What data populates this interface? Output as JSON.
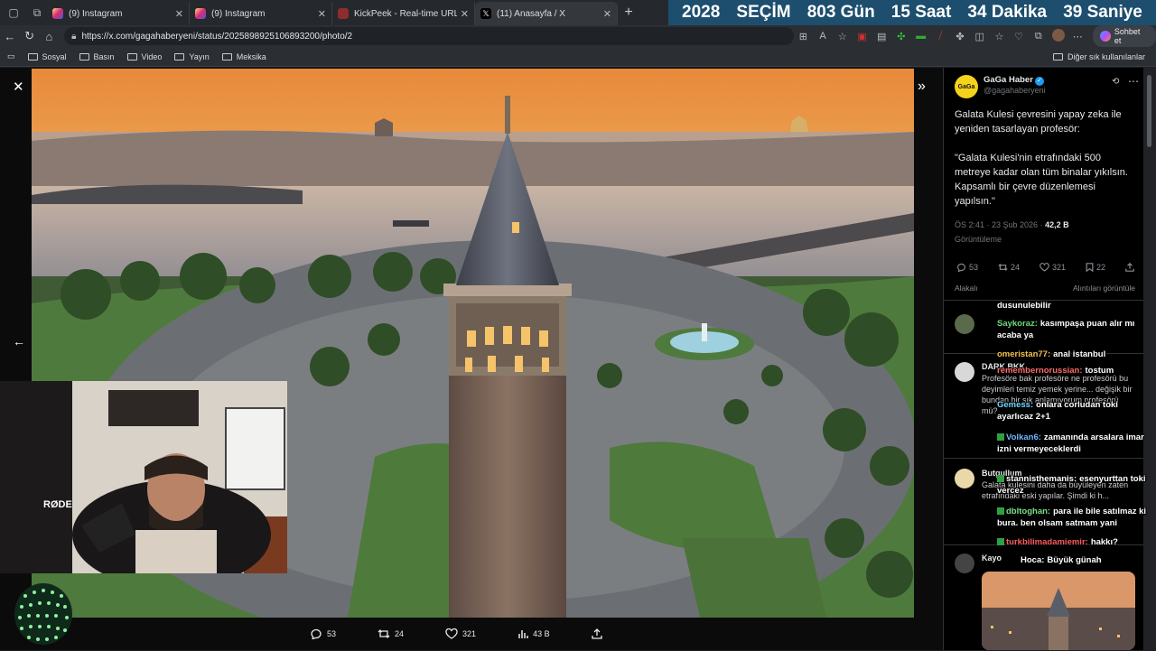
{
  "tabs": [
    {
      "title": "(9) Instagram",
      "favicon_color": "#d6306f"
    },
    {
      "title": "(9) Instagram",
      "favicon_color": "#d6306f"
    },
    {
      "title": "KickPeek - Real-time URL Crawler",
      "favicon_color": "#8e2d2d"
    },
    {
      "title": "(11) Anasayfa / X",
      "favicon_color": "#000000",
      "active": true
    }
  ],
  "banner": {
    "year": "2028",
    "label": "SEÇİM",
    "days": "803 Gün",
    "hours": "15 Saat",
    "minutes": "34 Dakika",
    "seconds": "39 Saniye"
  },
  "address": {
    "url": "https://x.com/gagahaberyeni/status/2025898925106893200/photo/2",
    "copilot_label": "Sohbet et"
  },
  "bookmarks": {
    "items": [
      "Sosyal",
      "Basın",
      "Video",
      "Yayın",
      "Meksika"
    ],
    "other": "Diğer sık kullanılanlar"
  },
  "viewer_actions": {
    "replies": "53",
    "reposts": "24",
    "likes": "321",
    "views": "43 B"
  },
  "tweet": {
    "name": "GaGa Haber",
    "handle": "@gagahaberyeni",
    "avatar_text": "GaGa",
    "text": "Galata Kulesi çevresini yapay zeka ile yeniden tasarlayan profesör:\n\n\"Galata Kulesi'nin etrafındaki 500 metreye kadar olan tüm binalar yıkılsın. Kapsamlı bir çevre düzenlemesi yapılsın.\"",
    "time": "ÖS 2:41 · 23 Şub 2026 · ",
    "views_count": "42,2 B",
    "views_label": "Görüntüleme",
    "replies": "53",
    "reposts": "24",
    "likes": "321",
    "bookmarks": "22",
    "sort_label": "Alakalı",
    "quotes_label": "Alıntıları görüntüle"
  },
  "replies": [
    {
      "name": "DARK BKK",
      "text": "Profesöre bak profesöre ne profesörü bu deyimleri temiz yemek yerine... değişik bir bundan bir şık anlamıyorum profesörü mü?"
    },
    {
      "name": "Butgullum",
      "text": "Galata kulesini daha da büyüleyen zaten etrafındaki eski yapılar. Şimdi ki h..."
    },
    {
      "name": "Kayo",
      "text": ""
    }
  ],
  "chat": [
    {
      "user": "",
      "text": "dusunulebilir"
    },
    {
      "user": "Saykoraz:",
      "text": "kasımpaşa puan alır mı acaba ya"
    },
    {
      "user": "omeristan77:",
      "text": "anal istanbul"
    },
    {
      "user": "remembernorussian:",
      "text": "tostum"
    },
    {
      "user": "Gemess:",
      "text": "onlara corludan toki ayarlıcaz 2+1"
    },
    {
      "user": "Volkan6:",
      "text": "zamanında arsalara imar izni vermeyeceklerdi"
    },
    {
      "user": "stannisthemanis:",
      "text": "esenyurttan toki vercez"
    },
    {
      "user": "dbltoghan:",
      "text": "para ile bile satılmaz ki bura. ben olsam satmam yani"
    },
    {
      "user": "turkbilimadamiemir:",
      "text": "hakkı?"
    },
    {
      "user": "Hoca:",
      "text": "Büyük günah"
    }
  ]
}
